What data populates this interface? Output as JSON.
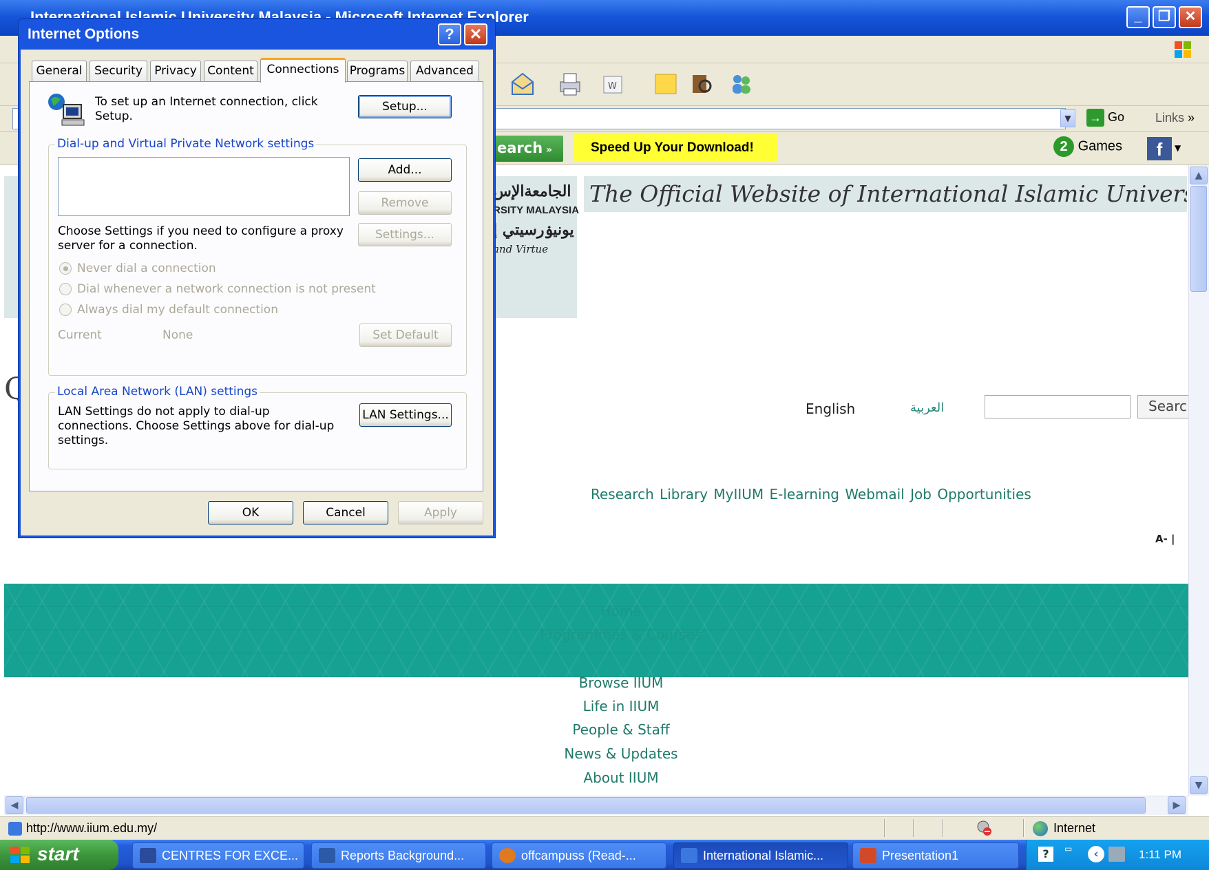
{
  "ie": {
    "title": "International Islamic University Malaysia - Microsoft Internet Explorer",
    "go_label": "Go",
    "links_label": "Links",
    "search_label": "earch",
    "speedup": "Speed Up Your Download!",
    "games": "Games"
  },
  "page": {
    "site_title": "The Official Website of International Islamic University Malaysi",
    "logo_arabic": "الجامعةالإس",
    "logo_en": "RSITY MALAYSIA",
    "logo_malay": "يونيۏرسيتي إ",
    "logo_motto": "and Virtue",
    "q_char": "Q",
    "lang_en": "English",
    "lang_ar": "العربية",
    "search_btn": "Searc",
    "quick_links": "Research Library MyIIUM E-learning Webmail Job Opportunities",
    "font_ctl": "A- |",
    "band_links": [
      "Home",
      "Programmes & Courses"
    ],
    "nav_links": [
      "Browse IIUM",
      "Life in IIUM",
      "People & Staff",
      "News & Updates",
      "About IIUM"
    ]
  },
  "status": {
    "url": "http://www.iium.edu.my/",
    "zone": "Internet"
  },
  "taskbar": {
    "start": "start",
    "tasks": [
      "CENTRES FOR EXCE...",
      "Reports Background...",
      "offcampuss (Read-...",
      "International Islamic...",
      "Presentation1"
    ],
    "clock": "1:11 PM"
  },
  "dialog": {
    "title": "Internet Options",
    "tabs": [
      "General",
      "Security",
      "Privacy",
      "Content",
      "Connections",
      "Programs",
      "Advanced"
    ],
    "setup_text": "To set up an Internet connection, click Setup.",
    "setup_btn": "Setup...",
    "dialup_group": "Dial-up and Virtual Private Network settings",
    "add_btn": "Add...",
    "remove_btn": "Remove",
    "settings_btn": "Settings...",
    "proxy_text": "Choose Settings if you need to configure a proxy server for a connection.",
    "radio_never": "Never dial a connection",
    "radio_whenever": "Dial whenever a network connection is not present",
    "radio_always": "Always dial my default connection",
    "current_label": "Current",
    "current_value": "None",
    "set_default_btn": "Set Default",
    "lan_group": "Local Area Network (LAN) settings",
    "lan_text": "LAN Settings do not apply to dial-up connections. Choose Settings above for dial-up settings.",
    "lan_btn": "LAN Settings...",
    "ok_btn": "OK",
    "cancel_btn": "Cancel",
    "apply_btn": "Apply"
  }
}
